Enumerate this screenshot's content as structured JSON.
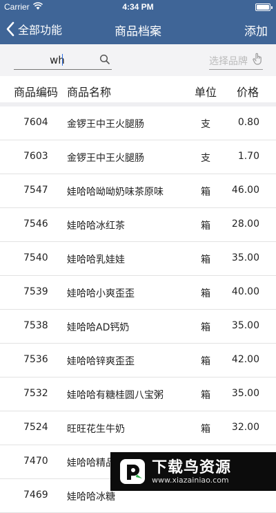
{
  "status_bar": {
    "carrier": "Carrier",
    "time": "4:34 PM"
  },
  "nav": {
    "back_label": "全部功能",
    "title": "商品档案",
    "add_label": "添加"
  },
  "search": {
    "value": "wh",
    "brand_placeholder": "选择品牌"
  },
  "columns": {
    "code": "商品编码",
    "name": "商品名称",
    "unit": "单位",
    "price": "价格"
  },
  "rows": [
    {
      "code": "7604",
      "name": "金锣王中王火腿肠",
      "unit": "支",
      "price": "0.80"
    },
    {
      "code": "7603",
      "name": "金锣王中王火腿肠",
      "unit": "支",
      "price": "1.70"
    },
    {
      "code": "7547",
      "name": "娃哈哈呦呦奶味茶原味",
      "unit": "箱",
      "price": "46.00"
    },
    {
      "code": "7546",
      "name": "娃哈哈冰红茶",
      "unit": "箱",
      "price": "28.00"
    },
    {
      "code": "7540",
      "name": "娃哈哈乳娃娃",
      "unit": "箱",
      "price": "35.00"
    },
    {
      "code": "7539",
      "name": "娃哈哈小爽歪歪",
      "unit": "箱",
      "price": "40.00"
    },
    {
      "code": "7538",
      "name": "娃哈哈AD钙奶",
      "unit": "箱",
      "price": "35.00"
    },
    {
      "code": "7536",
      "name": "娃哈哈锌爽歪歪",
      "unit": "箱",
      "price": "42.00"
    },
    {
      "code": "7532",
      "name": "娃哈哈有糖桂圆八宝粥",
      "unit": "箱",
      "price": "35.00"
    },
    {
      "code": "7524",
      "name": "旺旺花生牛奶",
      "unit": "箱",
      "price": "32.00"
    },
    {
      "code": "7470",
      "name": "娃哈哈精品",
      "unit": "",
      "price": ""
    },
    {
      "code": "7469",
      "name": "娃哈哈冰糖",
      "unit": "",
      "price": ""
    }
  ],
  "watermark": {
    "title": "下载鸟资源",
    "url": "www.xiazainiao.com"
  },
  "colors": {
    "nav_bg": "#3f6597",
    "search_bg": "#f3f3f5",
    "caret": "#2d6ee0"
  }
}
